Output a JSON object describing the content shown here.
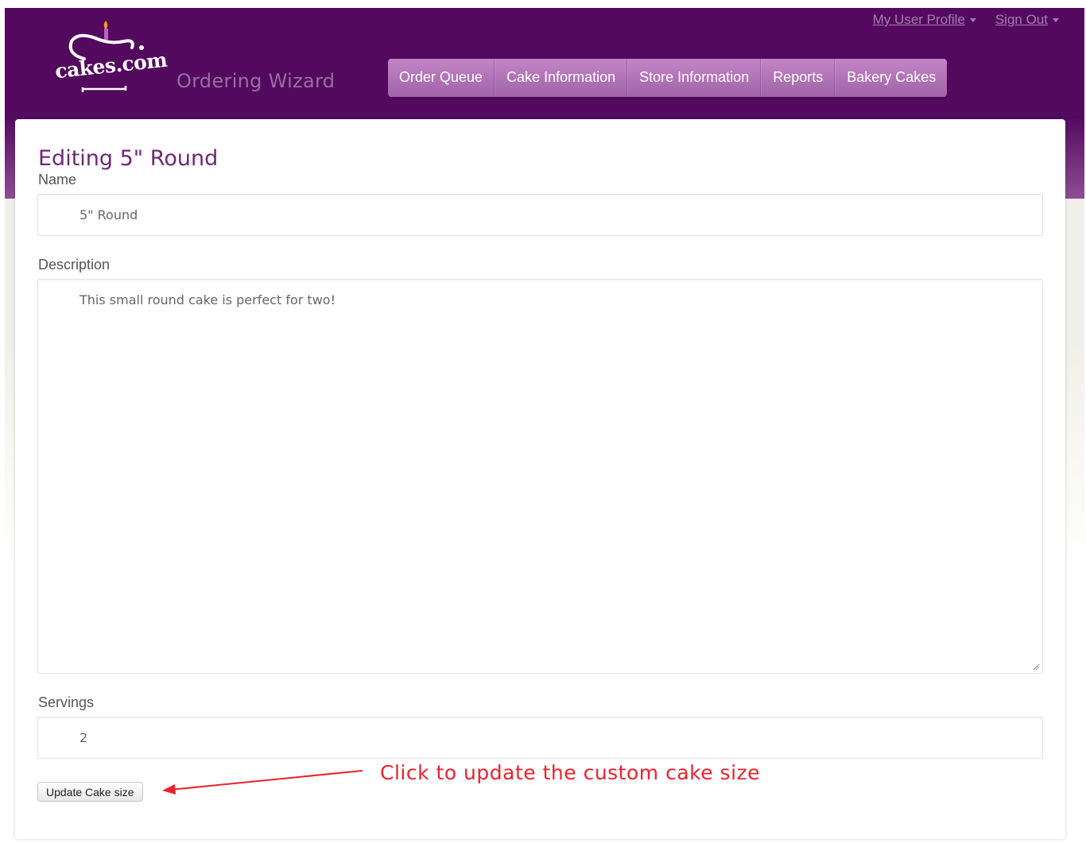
{
  "header": {
    "logo_text": "cakes.com",
    "app_title": "Ordering Wizard",
    "user_links": [
      {
        "label": "My User Profile"
      },
      {
        "label": "Sign Out"
      }
    ],
    "nav": [
      {
        "label": "Order Queue"
      },
      {
        "label": "Cake Information"
      },
      {
        "label": "Store Information"
      },
      {
        "label": "Reports"
      },
      {
        "label": "Bakery Cakes"
      }
    ]
  },
  "form": {
    "heading": "Editing 5\" Round",
    "name_label": "Name",
    "name_value": "5\" Round",
    "description_label": "Description",
    "description_value": "This small round cake is perfect for two!",
    "servings_label": "Servings",
    "servings_value": "2",
    "submit_label": "Update Cake size"
  },
  "annotation": {
    "text": "Click to update  the custom cake size",
    "color": "#e8232e"
  },
  "colors": {
    "header_bg": "#530a5e",
    "nav_bg": "#b06fb5",
    "heading": "#6c2a74"
  }
}
